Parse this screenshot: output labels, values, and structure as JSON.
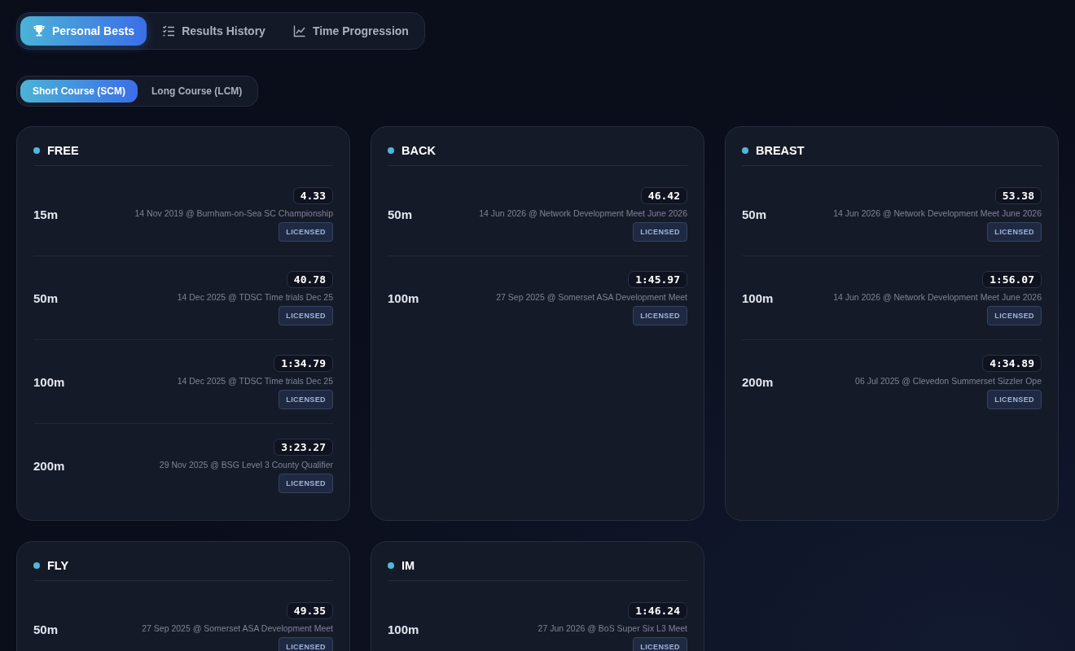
{
  "tabs": [
    {
      "label": "Personal Bests",
      "selected": true
    },
    {
      "label": "Results History",
      "selected": false
    },
    {
      "label": "Time Progression",
      "selected": false
    }
  ],
  "course_toggle": [
    {
      "label": "Short Course (SCM)",
      "selected": true
    },
    {
      "label": "Long Course (LCM)",
      "selected": false
    }
  ],
  "strokes": [
    {
      "name": "FREE",
      "color": "#4fb8d8",
      "events": [
        {
          "distance": "15m",
          "time": "4.33",
          "meet": "14 Nov 2019 @ Burnham-on-Sea SC Championship",
          "badge": "LICENSED"
        },
        {
          "distance": "50m",
          "time": "40.78",
          "meet": "14 Dec 2025 @ TDSC Time trials Dec 25",
          "badge": "LICENSED"
        },
        {
          "distance": "100m",
          "time": "1:34.79",
          "meet": "14 Dec 2025 @ TDSC Time trials Dec 25",
          "badge": "LICENSED"
        },
        {
          "distance": "200m",
          "time": "3:23.27",
          "meet": "29 Nov 2025 @ BSG Level 3 County Qualifier",
          "badge": "LICENSED"
        }
      ]
    },
    {
      "name": "BACK",
      "color": "#4fb8d8",
      "events": [
        {
          "distance": "50m",
          "time": "46.42",
          "meet": "14 Jun 2026 @ Network Development Meet June 2026",
          "badge": "LICENSED"
        },
        {
          "distance": "100m",
          "time": "1:45.97",
          "meet": "27 Sep 2025 @ Somerset ASA Development Meet",
          "badge": "LICENSED"
        }
      ]
    },
    {
      "name": "BREAST",
      "color": "#4fb8d8",
      "events": [
        {
          "distance": "50m",
          "time": "53.38",
          "meet": "14 Jun 2026 @ Network Development Meet June 2026",
          "badge": "LICENSED"
        },
        {
          "distance": "100m",
          "time": "1:56.07",
          "meet": "14 Jun 2026 @ Network Development Meet June 2026",
          "badge": "LICENSED"
        },
        {
          "distance": "200m",
          "time": "4:34.89",
          "meet": "06 Jul 2025 @ Clevedon Summerset Sizzler Ope",
          "badge": "LICENSED"
        }
      ]
    },
    {
      "name": "FLY",
      "color": "#4fb8d8",
      "events": [
        {
          "distance": "50m",
          "time": "49.35",
          "meet": "27 Sep 2025 @ Somerset ASA Development Meet",
          "badge": "LICENSED"
        }
      ]
    },
    {
      "name": "IM",
      "color": "#4fb8d8",
      "events": [
        {
          "distance": "100m",
          "time": "1:46.24",
          "meet": "27 Jun 2026 @ BoS Super Six L3 Meet",
          "badge": "LICENSED"
        }
      ]
    }
  ]
}
